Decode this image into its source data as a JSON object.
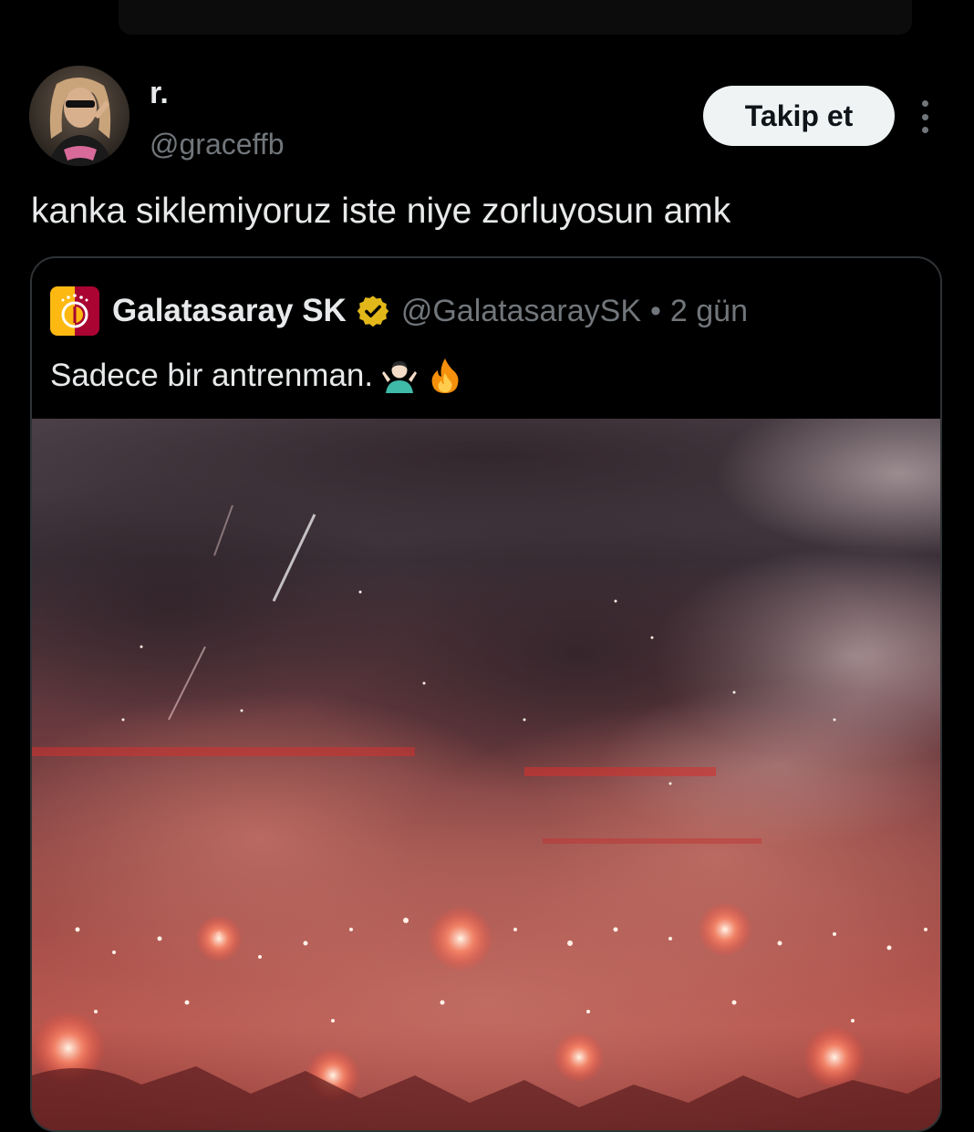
{
  "tweet": {
    "author": {
      "display_name": "r.",
      "handle": "@graceffb",
      "avatar_icon": "user-avatar-photo"
    },
    "follow_label": "Takip et",
    "more_icon": "more-vertical-icon",
    "text": "kanka siklemiyoruz iste niye zorluyosun amk"
  },
  "quote": {
    "name": "Galatasaray SK",
    "verified_icon": "verified-gold-badge-icon",
    "handle": "@GalatasaraySK",
    "separator": "•",
    "time": "2 gün",
    "text": "Sadece bir antrenman.",
    "emojis": [
      "person-shrugging-emoji",
      "fire-emoji"
    ],
    "media_icon": "stadium-flares-photo"
  },
  "colors": {
    "background": "#000000",
    "text_primary": "#e7e9ea",
    "text_secondary": "#71767b",
    "border": "#2f3336",
    "follow_button_bg": "#eff3f4",
    "verified_gold": "#e2b719"
  }
}
